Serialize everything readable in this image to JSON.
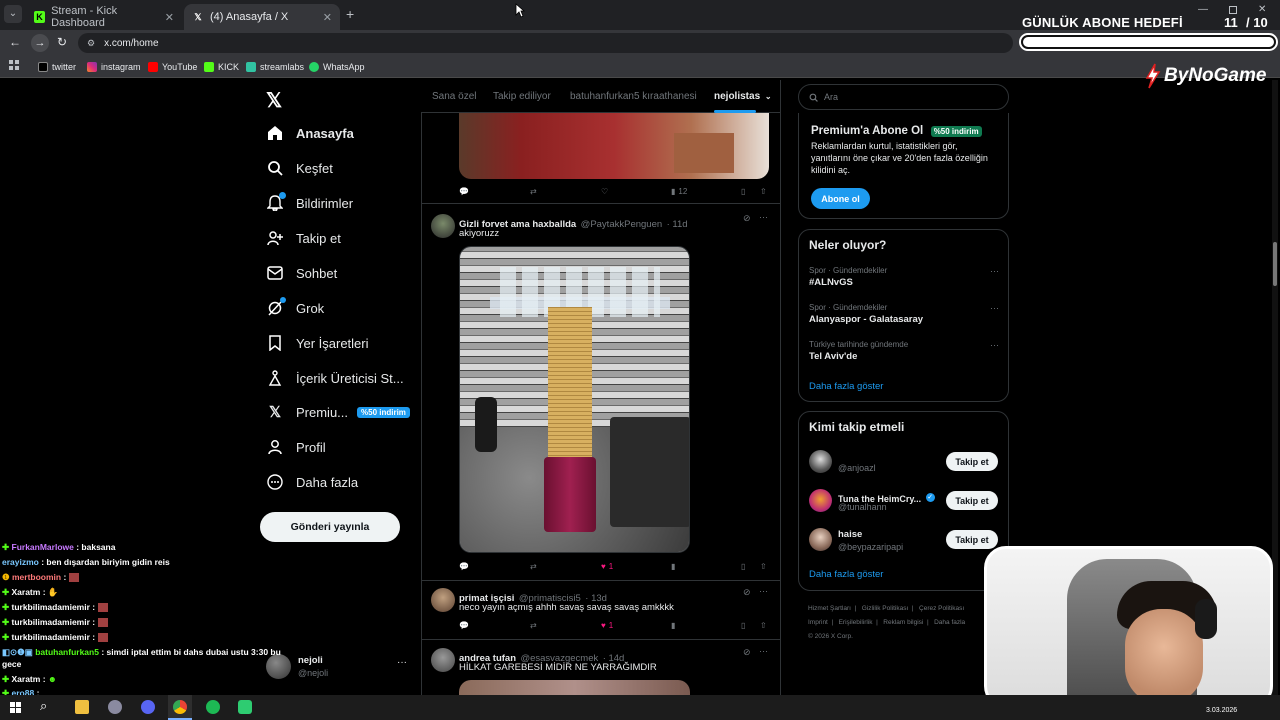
{
  "browser": {
    "tabs": [
      {
        "title": "Stream - Kick Dashboard",
        "active": false
      },
      {
        "title": "(4) Anasayfa / X",
        "active": true
      }
    ],
    "url": "x.com/home",
    "bookmarks": [
      "twitter",
      "instagram",
      "YouTube",
      "KICK",
      "streamlabs",
      "WhatsApp"
    ]
  },
  "overlay": {
    "goal_title": "GÜNLÜK ABONE HEDEFİ",
    "goal_count": "11",
    "goal_total": "/ 10",
    "brand": "ByNoGame"
  },
  "sidebar": {
    "items": [
      {
        "label": "Anasayfa",
        "icon": "home-icon"
      },
      {
        "label": "Keşfet",
        "icon": "search-icon"
      },
      {
        "label": "Bildirimler",
        "icon": "bell-icon"
      },
      {
        "label": "Takip et",
        "icon": "person-add-icon"
      },
      {
        "label": "Sohbet",
        "icon": "mail-icon"
      },
      {
        "label": "Grok",
        "icon": "grok-icon"
      },
      {
        "label": "Yer İşaretleri",
        "icon": "bookmark-icon"
      },
      {
        "label": "İçerik Üreticisi St...",
        "icon": "creator-icon"
      },
      {
        "label": "Premiu...",
        "icon": "x-logo-icon"
      },
      {
        "label": "Profil",
        "icon": "profile-icon"
      },
      {
        "label": "Daha fazla",
        "icon": "more-circle-icon"
      }
    ],
    "premium_badge": "%50 indirim",
    "post_button": "Gönderi yayınla",
    "account": {
      "name": "nejoli",
      "handle": "@nejoli"
    }
  },
  "feed": {
    "tabs": [
      "Sana özel",
      "Takip ediliyor",
      "batuhanfurkan5 kıraathanesi",
      "nejolistas"
    ],
    "first_tweet": {
      "views": "12"
    },
    "tweets": [
      {
        "name": "Gizli forvet ama haxballda",
        "handle": "@PaytakkPenguen",
        "time": "· 11d",
        "text": "akiyoruzz",
        "likes": "1"
      },
      {
        "name": "primat işçisi",
        "handle": "@primatiscisi5",
        "time": "· 13d",
        "text": "neco yayın açmış ahhh savaş savaş savaş amkkkk",
        "likes": "1"
      },
      {
        "name": "andrea tufan",
        "handle": "@esasvazgecmek",
        "time": "· 14d",
        "text": "HİLKAT GAREBESİ MİDİR NE YARRAĞIMDIR"
      }
    ]
  },
  "right": {
    "search_placeholder": "Ara",
    "premium": {
      "title": "Premium'a Abone Ol",
      "badge": "%50 indirim",
      "desc": "Reklamlardan kurtul, istatistikleri gör, yanıtlarını öne çıkar ve 20'den fazla özelliğin kilidini aç.",
      "button": "Abone ol"
    },
    "trends": {
      "title": "Neler oluyor?",
      "items": [
        {
          "context": "Spor · Gündemdekiler",
          "name": "#ALNvGS"
        },
        {
          "context": "Spor · Gündemdekiler",
          "name": "Alanyaspor - Galatasaray"
        },
        {
          "context": "Türkiye tarihinde gündemde",
          "name": "Tel Aviv'de"
        }
      ],
      "more": "Daha fazla göster"
    },
    "who": {
      "title": "Kimi takip etmeli",
      "items": [
        {
          "name": "",
          "handle": "@anjoazl"
        },
        {
          "name": "Tuna the HeimCry...",
          "handle": "@tunalhann"
        },
        {
          "name": "haise",
          "handle": "@beypazaripapi"
        }
      ],
      "follow": "Takip et",
      "more": "Daha fazla göster"
    },
    "footer": [
      "Hizmet Şartları",
      "Gizlilik Politikası",
      "Çerez Politikası",
      "Imprint",
      "Erişilebilirlik",
      "Reklam bilgisi",
      "Daha fazla",
      "© 2026 X Corp."
    ]
  },
  "chat": [
    {
      "user": "FurkanMarlowe",
      "msg": ": baksana"
    },
    {
      "user": "erayizmo",
      "msg": ": ben dışardan biriyim gidin reis"
    },
    {
      "user": "mertboomin",
      "msg": ":"
    },
    {
      "user": "Xaratm",
      "msg": ":"
    },
    {
      "user": "turkbilimadamiemir",
      "msg": ":"
    },
    {
      "user": "turkbilimadamiemir",
      "msg": ":"
    },
    {
      "user": "turkbilimadamiemir",
      "msg": ":"
    },
    {
      "user": "batuhanfurkan5",
      "msg": ": simdi iptal ettim bi dahs dubai ustu 3:30 bu"
    },
    {
      "user": "",
      "msg": "gece"
    },
    {
      "user": "Xaratm",
      "msg": ":"
    },
    {
      "user": "ero88",
      "msg": ":"
    }
  ],
  "taskbar": {
    "date": "3.03.2026"
  }
}
